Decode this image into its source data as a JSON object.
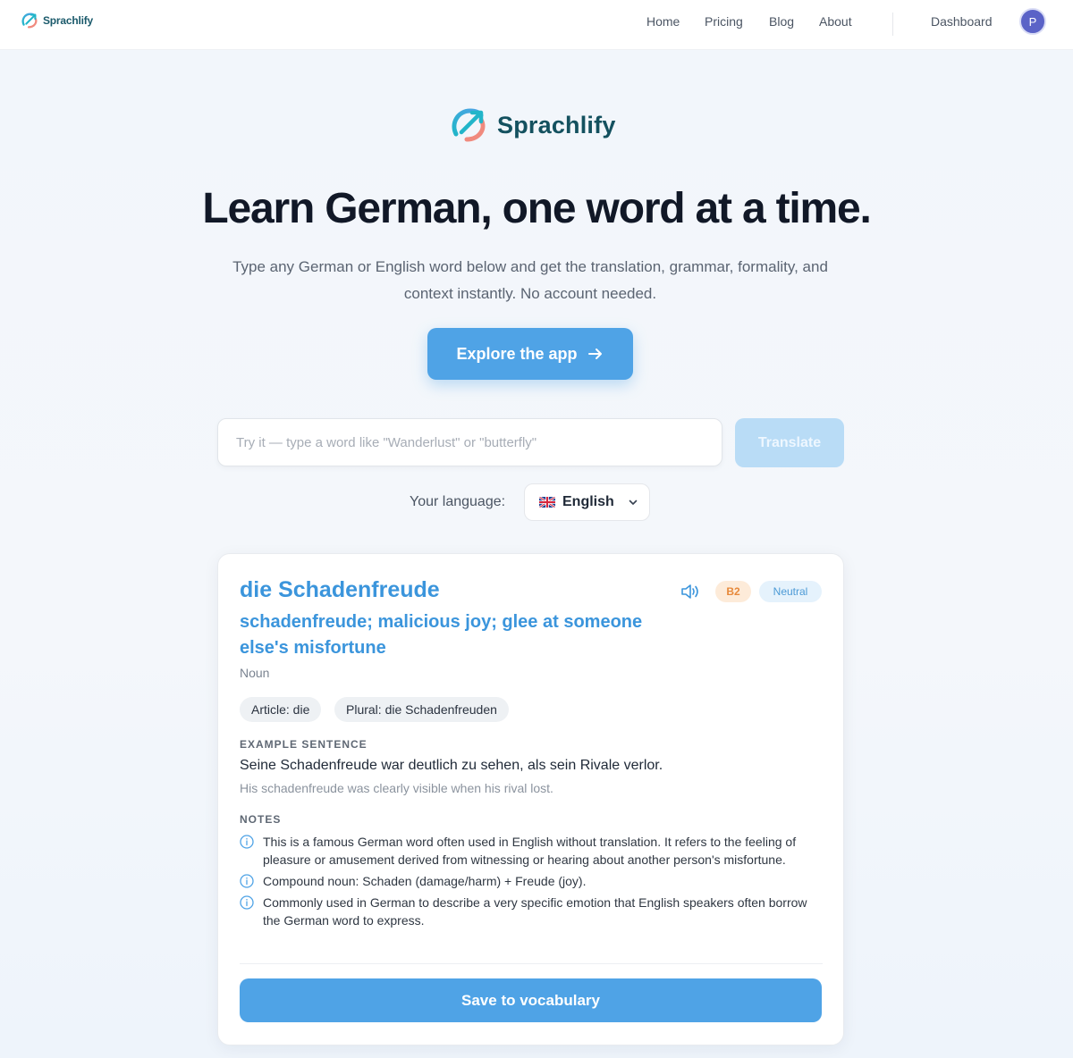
{
  "colors": {
    "accent": "#4fa3e6",
    "brand": "#14515f",
    "level_badge": "#e7893b",
    "formality_badge": "#4c9ad6"
  },
  "nav": {
    "logo_text": "Sprachlify",
    "links": [
      "Home",
      "Pricing",
      "Blog",
      "About"
    ],
    "dashboard": "Dashboard",
    "avatar_initial": "P"
  },
  "hero": {
    "brand": "Sprachlify",
    "headline": "Learn German, one word at a time.",
    "subtitle": "Type any German or English word below and get the translation, grammar, formality, and context instantly. No account needed.",
    "cta": "Explore the app"
  },
  "search": {
    "placeholder": "Try it — type a word like \"Wanderlust\" or \"butterfly\"",
    "value": "",
    "button": "Translate"
  },
  "language": {
    "label": "Your language:",
    "selected": "English",
    "flag_icon": "uk-flag-icon"
  },
  "result": {
    "word": "die Schadenfreude",
    "translation": "schadenfreude; malicious joy; glee at someone else's misfortune",
    "part_of_speech": "Noun",
    "level": "B2",
    "formality": "Neutral",
    "chips": [
      "Article: die",
      "Plural: die Schadenfreuden"
    ],
    "example_label": "EXAMPLE SENTENCE",
    "example_de": "Seine Schadenfreude war deutlich zu sehen, als sein Rivale verlor.",
    "example_en": "His schadenfreude was clearly visible when his rival lost.",
    "notes_label": "NOTES",
    "notes": [
      "This is a famous German word often used in English without translation. It refers to the feeling of pleasure or amusement derived from witnessing or hearing about another person's misfortune.",
      "Compound noun: Schaden (damage/harm) + Freude (joy).",
      "Commonly used in German to describe a very specific emotion that English speakers often borrow the German word to express."
    ],
    "save_button": "Save to vocabulary"
  }
}
